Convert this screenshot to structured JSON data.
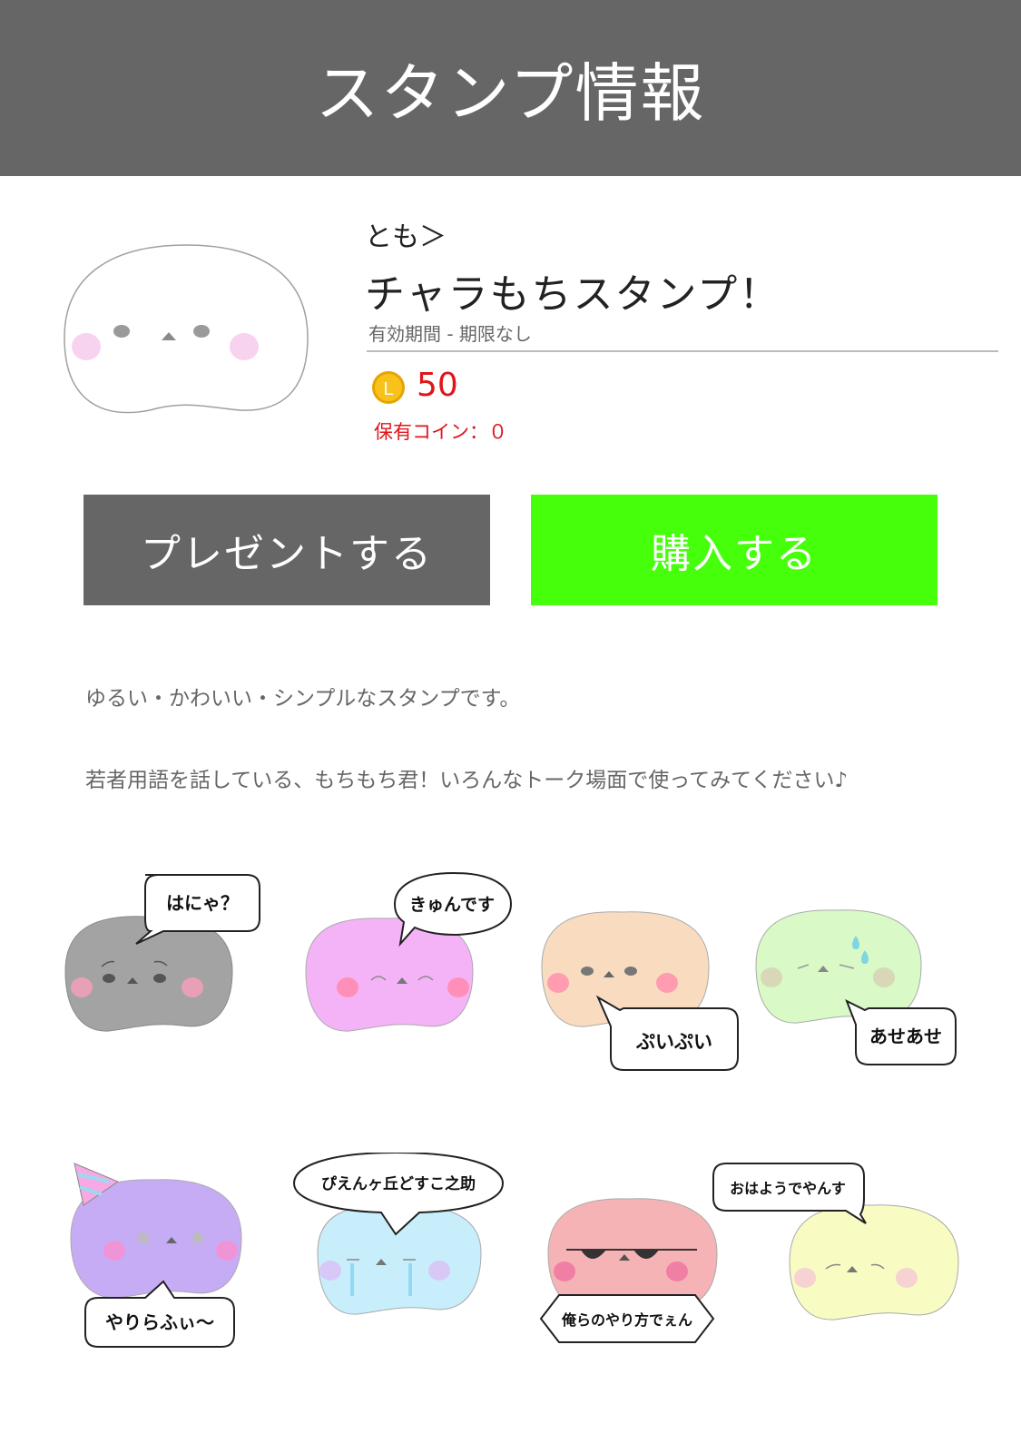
{
  "header": {
    "title": "スタンプ情報"
  },
  "product": {
    "author": "とも＞",
    "title": "チャラもちスタンプ！",
    "validity": "有効期間 - 期限なし",
    "coin_symbol": "L",
    "price": "50",
    "owned_coins": "保有コイン：０"
  },
  "buttons": {
    "present": "プレゼントする",
    "buy": "購入する"
  },
  "description": {
    "line1": "ゆるい・かわいい・シンプルなスタンプです。",
    "line2": "若者用語を話している、もちもち君！いろんなトーク場面で使ってみてください♪"
  },
  "stamps": [
    {
      "text": "はにゃ？",
      "color": "#a3a3a3"
    },
    {
      "text": "きゅんです",
      "color": "#f5b3f7"
    },
    {
      "text": "ぷいぷい",
      "color": "#f9dcc0"
    },
    {
      "text": "あせあせ",
      "color": "#d9f9c6"
    },
    {
      "text": "やりらふぃ〜",
      "color": "#c6acf5"
    },
    {
      "text": "ぴえんヶ丘どすこ之助",
      "color": "#c8eefb"
    },
    {
      "text": "俺らのやり方でぇん",
      "color": "#f6b3b5"
    },
    {
      "text": "おはようでやんす",
      "color": "#f8fbc2"
    }
  ],
  "colors": {
    "header_bg": "#666666",
    "present_bg": "#666666",
    "buy_bg": "#46ff0a",
    "price": "#e0151b",
    "coin": "#f5b400"
  }
}
